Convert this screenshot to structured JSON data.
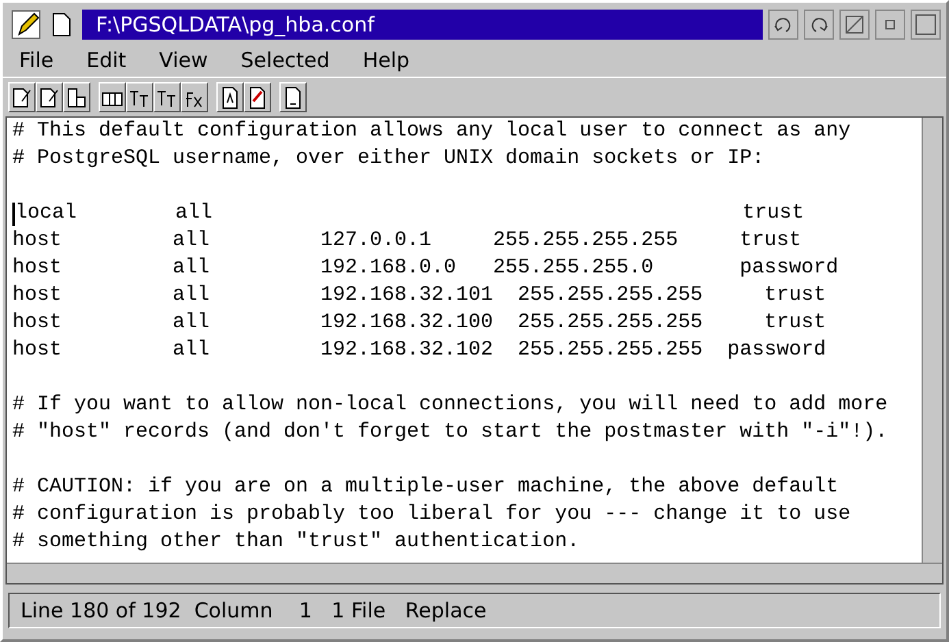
{
  "window": {
    "title": "F:\\PGSQLDATA\\pg_hba.conf"
  },
  "menu": [
    "File",
    "Edit",
    "View",
    "Selected",
    "Help"
  ],
  "toolbar_groups": [
    [
      {
        "kind": "page-edit"
      },
      {
        "kind": "page-edit"
      },
      {
        "kind": "page-chart"
      }
    ],
    [
      {
        "kind": "grid"
      },
      {
        "kind": "text-t"
      },
      {
        "kind": "text-t"
      },
      {
        "kind": "fx"
      }
    ],
    [
      {
        "kind": "page-a"
      },
      {
        "kind": "page-mark"
      }
    ],
    [
      {
        "kind": "page-blank"
      }
    ]
  ],
  "editor": {
    "lines": [
      {
        "text": "# This default configuration allows any local user to connect as any",
        "cursor": false
      },
      {
        "text": "# PostgreSQL username, over either UNIX domain sockets or IP:",
        "cursor": false
      },
      {
        "cursor": false
      },
      {
        "text": "local        all                                           trust",
        "cursor": true
      },
      {
        "text": "host         all         127.0.0.1     255.255.255.255     trust",
        "cursor": false
      },
      {
        "text": "host         all         192.168.0.0   255.255.255.0       password",
        "cursor": false
      },
      {
        "text": "host         all         192.168.32.101  255.255.255.255     trust",
        "cursor": false
      },
      {
        "text": "host         all         192.168.32.100  255.255.255.255     trust",
        "cursor": false
      },
      {
        "text": "host         all         192.168.32.102  255.255.255.255  password",
        "cursor": false
      },
      {
        "cursor": false
      },
      {
        "text": "# If you want to allow non-local connections, you will need to add more",
        "cursor": false
      },
      {
        "text": "# \"host\" records (and don't forget to start the postmaster with \"-i\"!).",
        "cursor": false
      },
      {
        "cursor": false
      },
      {
        "text": "# CAUTION: if you are on a multiple-user machine, the above default",
        "cursor": false
      },
      {
        "text": "# configuration is probably too liberal for you --- change it to use",
        "cursor": false
      },
      {
        "text": "# something other than \"trust\" authentication.",
        "cursor": false
      }
    ]
  },
  "status_bar": {
    "text": "Line 180 of 192  Column    1   1 File   Replace"
  }
}
